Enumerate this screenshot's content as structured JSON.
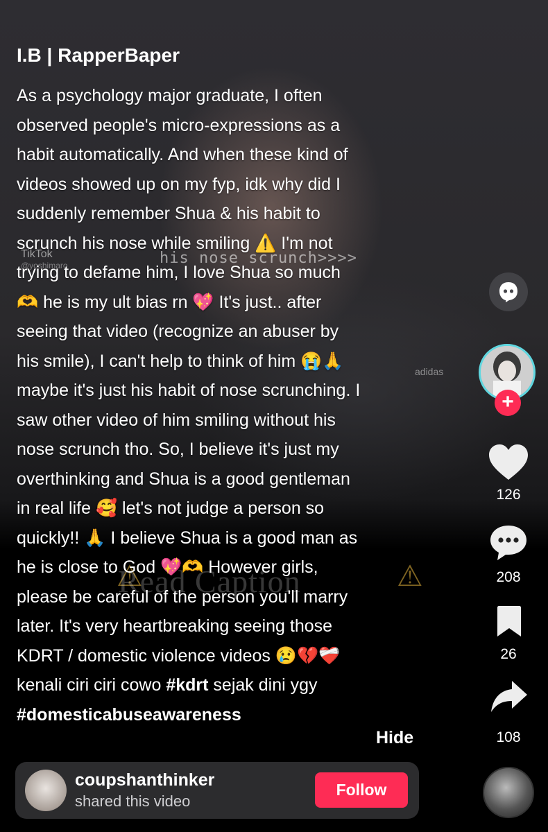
{
  "video": {
    "watermark": "TikTok",
    "watermark_handle": "@yoshimaro",
    "overlay_text": "his nose scrunch>>>>",
    "read_caption": "Read Caption",
    "brand": "adidas"
  },
  "post": {
    "username": "I.B | RapperBaper",
    "caption_lines": [
      "As a psychology major graduate, I often",
      "observed people's micro-expressions as a",
      "habit automatically. And when these kind of",
      "videos showed up on my fyp, idk why did I",
      "suddenly remember Shua & his habit to",
      "scrunch his nose while smiling ⚠️ I'm not",
      "trying to defame him, I love Shua so much",
      "🫶 he is my ult bias rn 💖 It's just.. after",
      "seeing that video (recognize an abuser by",
      "his smile), I can't help to think of him 😭🙏",
      "maybe it's just his habit of nose scrunching. I",
      "saw other video of him smiling without his",
      "nose scrunch tho. So, I believe it's just my",
      "overthinking and Shua is a good gentleman",
      "in real life 🥰 let's not judge a person so",
      "quickly!! 🙏 I believe Shua is a good man as",
      "he is close to God 💖🫶 However girls,",
      "please be careful of the person you'll marry",
      "later. It's very heartbreaking seeing those",
      "KDRT / domestic violence videos 😢💔❤️‍🩹"
    ],
    "caption_line_21_pre": "kenali ciri ciri cowo ",
    "caption_line_21_tag": "#kdrt",
    "caption_line_21_post": " sejak dini ygy",
    "caption_line_22_tag": "#domesticabuseawareness",
    "hide_label": "Hide"
  },
  "actions": {
    "likes": "126",
    "comments": "208",
    "saves": "26",
    "shares": "108"
  },
  "shared_by": {
    "username": "coupshanthinker",
    "subtitle": "shared this video",
    "follow_label": "Follow"
  },
  "colors": {
    "accent": "#fe2c55",
    "avatar_ring": "#5fd7e0",
    "panel": "#2c2c2e"
  }
}
